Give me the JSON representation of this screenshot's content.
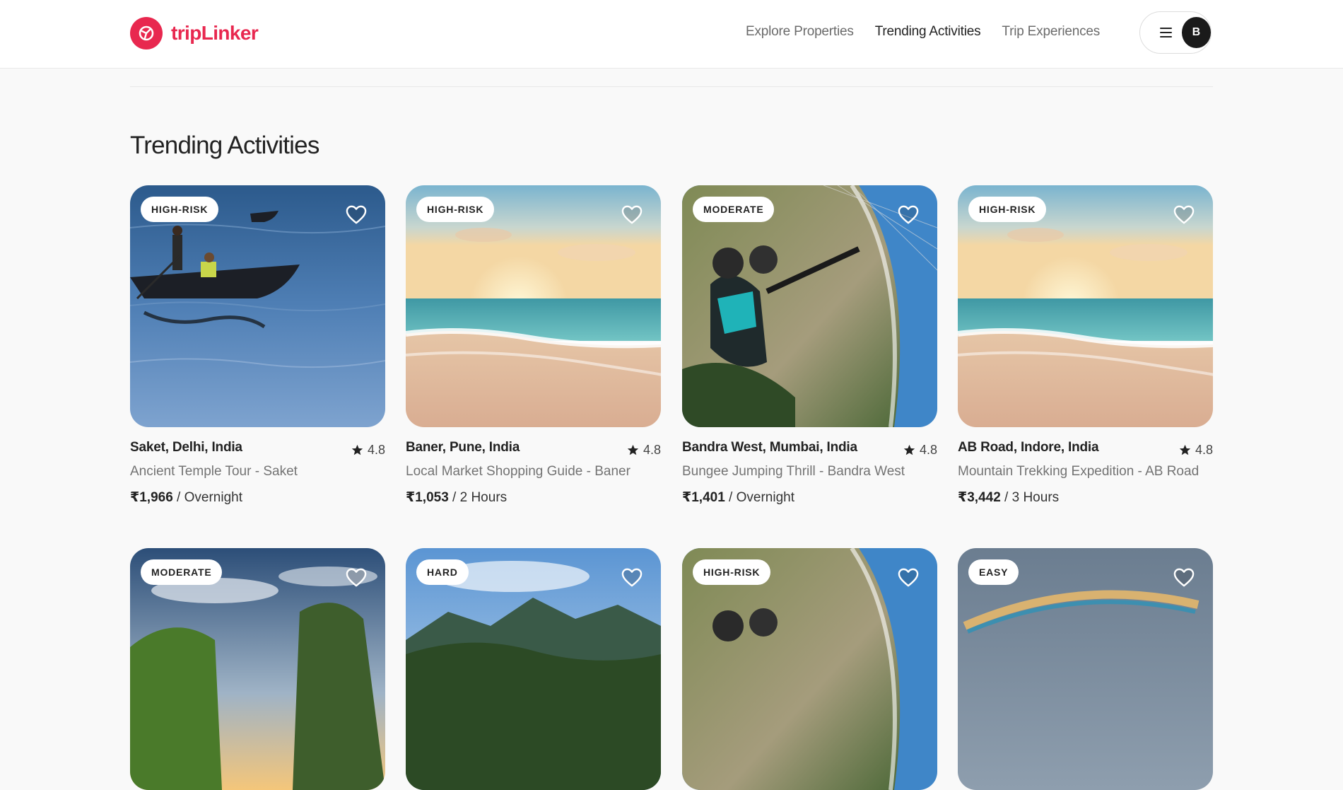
{
  "brand": {
    "name": "tripLinker",
    "color": "#e8284f",
    "icon": "logo-icon"
  },
  "nav": {
    "items": [
      {
        "label": "Explore Properties",
        "active": false
      },
      {
        "label": "Trending Activities",
        "active": true
      },
      {
        "label": "Trip Experiences",
        "active": false
      }
    ]
  },
  "user": {
    "initial": "B",
    "menu_icon": "hamburger-icon"
  },
  "section": {
    "title": "Trending Activities"
  },
  "cards": [
    {
      "badge": "HIGH-RISK",
      "location": "Saket, Delhi, India",
      "rating": "4.8",
      "activity": "Ancient Temple Tour - Saket",
      "price": "₹1,966",
      "unit": " / Overnight",
      "image": "boat-lake"
    },
    {
      "badge": "HIGH-RISK",
      "location": "Baner, Pune, India",
      "rating": "4.8",
      "activity": "Local Market Shopping Guide - Baner",
      "price": "₹1,053",
      "unit": " / 2 Hours",
      "image": "beach-sunset"
    },
    {
      "badge": "MODERATE",
      "location": "Bandra West, Mumbai, India",
      "rating": "4.8",
      "activity": "Bungee Jumping Thrill - Bandra West",
      "price": "₹1,401",
      "unit": " / Overnight",
      "image": "paragliding"
    },
    {
      "badge": "HIGH-RISK",
      "location": "AB Road, Indore, India",
      "rating": "4.8",
      "activity": "Mountain Trekking Expedition - AB Road",
      "price": "₹3,442",
      "unit": " / 3 Hours",
      "image": "beach-sunset"
    },
    {
      "badge": "MODERATE",
      "image": "green-hills-sunset"
    },
    {
      "badge": "HARD",
      "image": "tropical-mountains"
    },
    {
      "badge": "HIGH-RISK",
      "image": "paragliding"
    },
    {
      "badge": "EASY",
      "image": "paraglider-wing"
    }
  ]
}
